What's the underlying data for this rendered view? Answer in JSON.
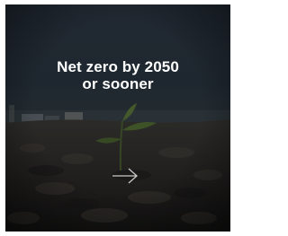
{
  "card": {
    "headline_line1": "Net zero by 2050",
    "headline_line2": "or sooner",
    "arrow_icon": "arrow-right-icon"
  },
  "colors": {
    "text": "#ffffff",
    "overlay": "#1b1e22",
    "arrow": "#c9c9c9"
  }
}
